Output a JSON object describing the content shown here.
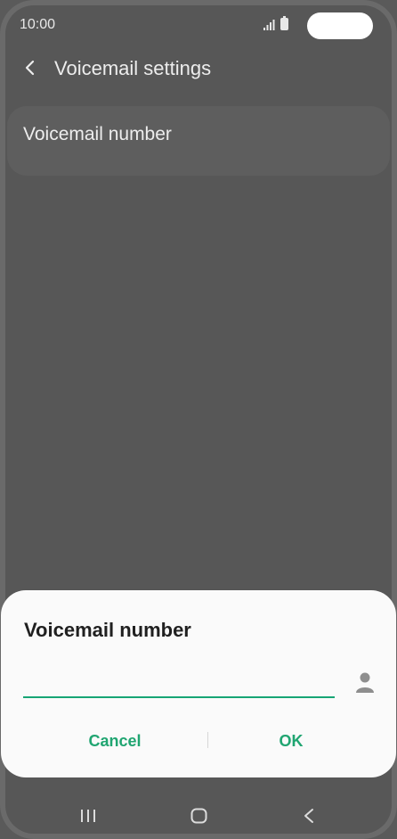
{
  "status_bar": {
    "time": "10:00",
    "icons": [
      "signal-icon",
      "battery-icon"
    ]
  },
  "header": {
    "title": "Voicemail settings",
    "back_icon": "chevron-left-icon"
  },
  "settings": {
    "items": [
      {
        "label": "Voicemail number"
      }
    ]
  },
  "dialog": {
    "title": "Voicemail number",
    "input_value": "",
    "input_placeholder": "",
    "contact_icon": "person-icon",
    "cancel_label": "Cancel",
    "ok_label": "OK"
  },
  "nav_bar": {
    "icons": [
      "recents-icon",
      "home-icon",
      "back-icon"
    ]
  },
  "colors": {
    "accent": "#20a571",
    "dialog_background": "#fafafa",
    "screen_dim": "#575757"
  }
}
